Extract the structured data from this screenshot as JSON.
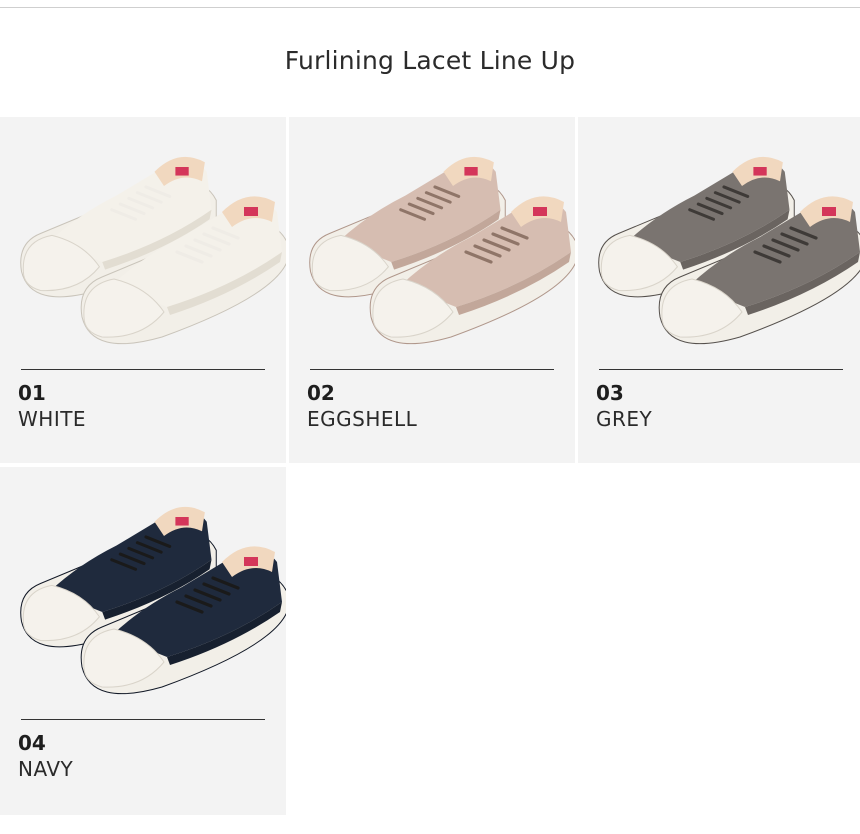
{
  "title": "Furlining Lacet Line Up",
  "items": [
    {
      "number": "01",
      "name": "WHITE",
      "canvas": "#f4f1ea",
      "shade": "#e2ddd2",
      "lace": "#efece6",
      "lining": "#f1d8bf",
      "edge": "#c9c4ba"
    },
    {
      "number": "02",
      "name": "EGGSHELL",
      "canvas": "#d6bdb1",
      "shade": "#c2a79a",
      "lace": "#8f7568",
      "lining": "#f1d8bf",
      "edge": "#b0978b"
    },
    {
      "number": "03",
      "name": "GREY",
      "canvas": "#7a7470",
      "shade": "#6a6460",
      "lace": "#3e3a37",
      "lining": "#f1d8bf",
      "edge": "#55504c"
    },
    {
      "number": "04",
      "name": "NAVY",
      "canvas": "#1f2a3d",
      "shade": "#17202f",
      "lace": "#1a1a1a",
      "lining": "#f1d8bf",
      "edge": "#111826"
    }
  ]
}
